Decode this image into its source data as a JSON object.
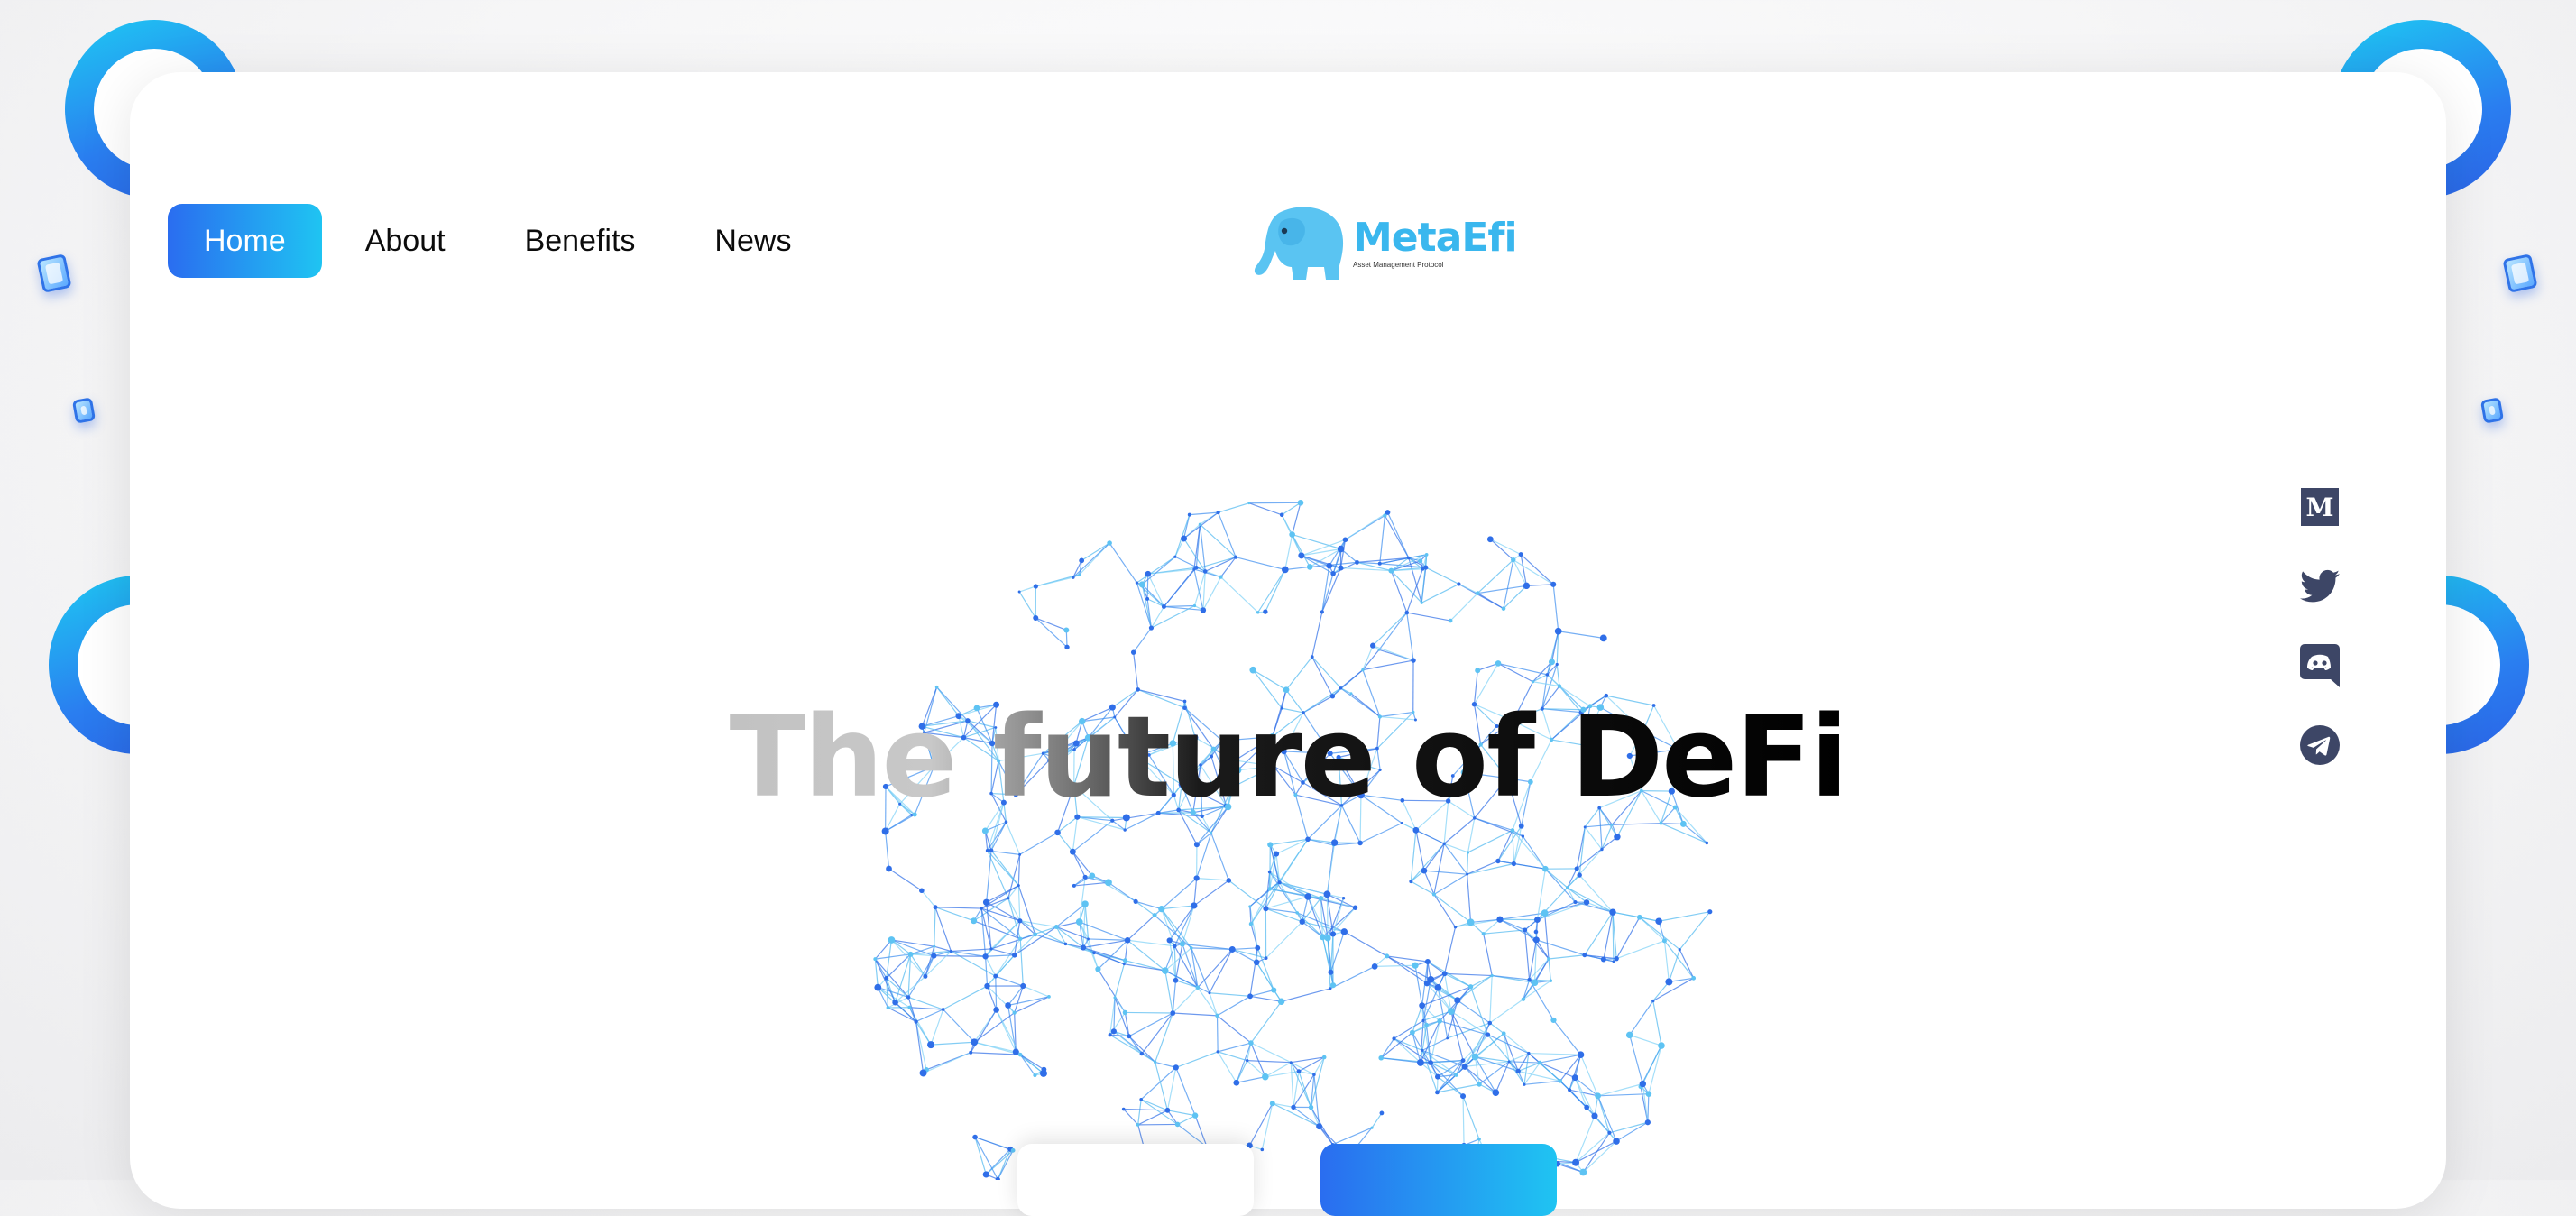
{
  "nav": {
    "items": [
      {
        "label": "Home",
        "active": true
      },
      {
        "label": "About",
        "active": false
      },
      {
        "label": "Benefits",
        "active": false
      },
      {
        "label": "News",
        "active": false
      }
    ]
  },
  "logo": {
    "name": "MetaEfi",
    "tagline": "Asset Management Protocol",
    "icon": "elephant-icon",
    "color": "#3ab7ee"
  },
  "hero": {
    "headline": "The future of DeFi"
  },
  "social": [
    {
      "icon": "medium-icon"
    },
    {
      "icon": "twitter-icon"
    },
    {
      "icon": "discord-icon"
    },
    {
      "icon": "telegram-icon"
    }
  ],
  "cta": {
    "secondary_label": "",
    "primary_label": ""
  },
  "colors": {
    "accent_start": "#2a6df0",
    "accent_end": "#1fc4f2",
    "icon": "#3d4666"
  }
}
